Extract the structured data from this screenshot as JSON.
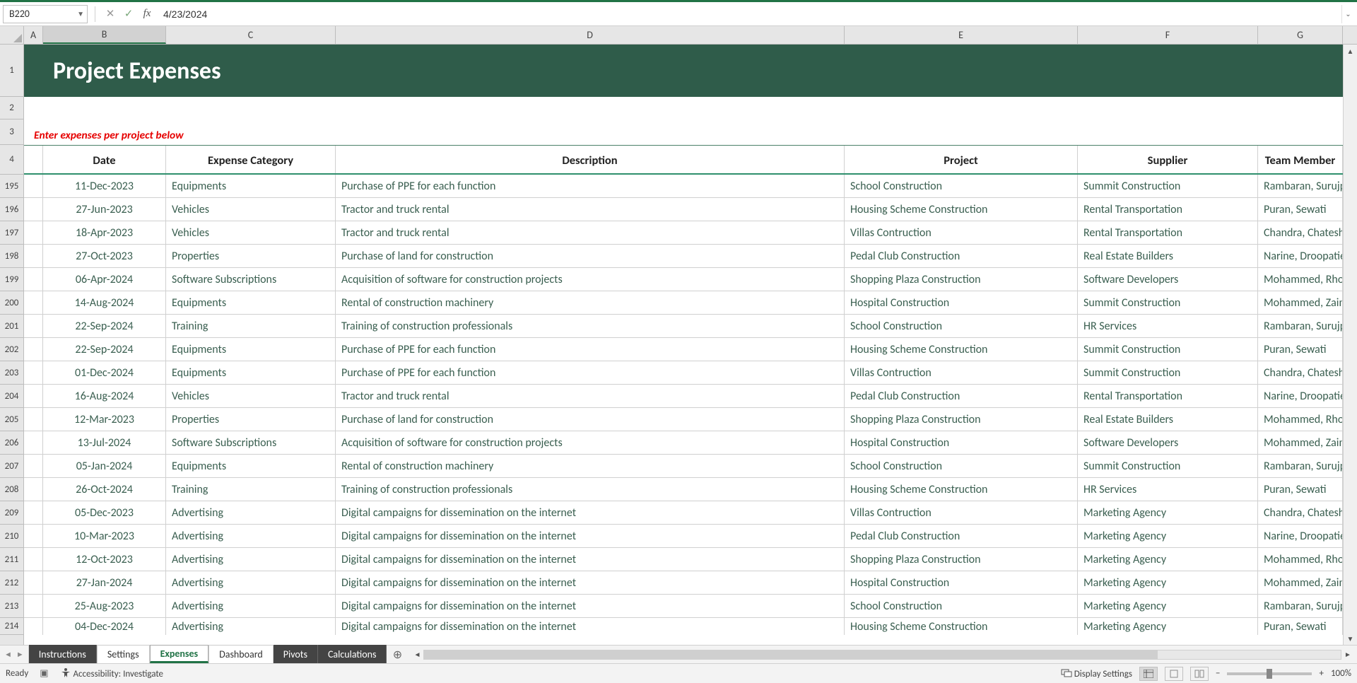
{
  "formula_bar": {
    "cell_ref": "B220",
    "formula": "4/23/2024",
    "cancel": "✕",
    "confirm": "✓",
    "fx": "fx"
  },
  "columns": [
    "A",
    "B",
    "C",
    "D",
    "E",
    "F",
    "G"
  ],
  "title": "Project Expenses",
  "instruction": "Enter expenses per project below",
  "headers": {
    "date": "Date",
    "cat": "Expense Category",
    "desc": "Description",
    "proj": "Project",
    "supp": "Supplier",
    "team": "Team Member"
  },
  "row_numbers_top": [
    "1",
    "2",
    "3",
    "4"
  ],
  "row_numbers_data": [
    "195",
    "196",
    "197",
    "198",
    "199",
    "200",
    "201",
    "202",
    "203",
    "204",
    "205",
    "206",
    "207",
    "208",
    "209",
    "210",
    "211",
    "212",
    "213",
    "214"
  ],
  "rows": [
    {
      "date": "11-Dec-2023",
      "cat": "Equipments",
      "desc": "Purchase of PPE for each function",
      "proj": "School Construction",
      "supp": "Summit Construction",
      "team": "Rambaran, Surujpaul"
    },
    {
      "date": "27-Jun-2023",
      "cat": "Vehicles",
      "desc": "Tractor and truck rental",
      "proj": "Housing Scheme Construction",
      "supp": "Rental Transportation",
      "team": "Puran, Sewati"
    },
    {
      "date": "18-Apr-2023",
      "cat": "Vehicles",
      "desc": "Tractor and truck rental",
      "proj": "Villas Contruction",
      "supp": "Rental Transportation",
      "team": "Chandra, Chateshwar"
    },
    {
      "date": "27-Oct-2023",
      "cat": "Properties",
      "desc": "Purchase of land for construction",
      "proj": "Pedal Club Construction",
      "supp": "Real Estate Builders",
      "team": "Narine, Droopatie"
    },
    {
      "date": "06-Apr-2024",
      "cat": "Software Subscriptions",
      "desc": "Acquisition of software for construction projects",
      "proj": "Shopping Plaza Construction",
      "supp": "Software Developers",
      "team": "Mohammed, Rhona"
    },
    {
      "date": "14-Aug-2024",
      "cat": "Equipments",
      "desc": "Rental of construction machinery",
      "proj": "Hospital Construction",
      "supp": "Summit Construction",
      "team": "Mohammed, Zainool"
    },
    {
      "date": "22-Sep-2024",
      "cat": "Training",
      "desc": "Training of construction professionals",
      "proj": "School Construction",
      "supp": "HR Services",
      "team": "Rambaran, Surujpaul"
    },
    {
      "date": "22-Sep-2024",
      "cat": "Equipments",
      "desc": "Purchase of PPE for each function",
      "proj": "Housing Scheme Construction",
      "supp": "Summit Construction",
      "team": "Puran, Sewati"
    },
    {
      "date": "01-Dec-2024",
      "cat": "Equipments",
      "desc": "Purchase of PPE for each function",
      "proj": "Villas Contruction",
      "supp": "Summit Construction",
      "team": "Chandra, Chateshwar"
    },
    {
      "date": "16-Aug-2024",
      "cat": "Vehicles",
      "desc": "Tractor and truck rental",
      "proj": "Pedal Club Construction",
      "supp": "Rental Transportation",
      "team": "Narine, Droopatie"
    },
    {
      "date": "12-Mar-2023",
      "cat": "Properties",
      "desc": "Purchase of land for construction",
      "proj": "Shopping Plaza Construction",
      "supp": "Real Estate Builders",
      "team": "Mohammed, Rhona"
    },
    {
      "date": "13-Jul-2024",
      "cat": "Software Subscriptions",
      "desc": "Acquisition of software for construction projects",
      "proj": "Hospital Construction",
      "supp": "Software Developers",
      "team": "Mohammed, Zainool"
    },
    {
      "date": "05-Jan-2024",
      "cat": "Equipments",
      "desc": "Rental of construction machinery",
      "proj": "School Construction",
      "supp": "Summit Construction",
      "team": "Rambaran, Surujpaul"
    },
    {
      "date": "26-Oct-2024",
      "cat": "Training",
      "desc": "Training of construction professionals",
      "proj": "Housing Scheme Construction",
      "supp": "HR Services",
      "team": "Puran, Sewati"
    },
    {
      "date": "05-Dec-2023",
      "cat": "Advertising",
      "desc": "Digital campaigns for dissemination on the internet",
      "proj": "Villas Contruction",
      "supp": "Marketing Agency",
      "team": "Chandra, Chateshwar"
    },
    {
      "date": "10-Mar-2023",
      "cat": "Advertising",
      "desc": "Digital campaigns for dissemination on the internet",
      "proj": "Pedal Club Construction",
      "supp": "Marketing Agency",
      "team": "Narine, Droopatie"
    },
    {
      "date": "12-Oct-2023",
      "cat": "Advertising",
      "desc": "Digital campaigns for dissemination on the internet",
      "proj": "Shopping Plaza Construction",
      "supp": "Marketing Agency",
      "team": "Mohammed, Rhona"
    },
    {
      "date": "27-Jan-2024",
      "cat": "Advertising",
      "desc": "Digital campaigns for dissemination on the internet",
      "proj": "Hospital Construction",
      "supp": "Marketing Agency",
      "team": "Mohammed, Zainool"
    },
    {
      "date": "25-Aug-2023",
      "cat": "Advertising",
      "desc": "Digital campaigns for dissemination on the internet",
      "proj": "School Construction",
      "supp": "Marketing Agency",
      "team": "Rambaran, Surujpaul"
    },
    {
      "date": "04-Dec-2024",
      "cat": "Advertising",
      "desc": "Digital campaigns for dissemination on the internet",
      "proj": "Housing Scheme Construction",
      "supp": "Marketing Agency",
      "team": "Puran, Sewati"
    }
  ],
  "tabs": {
    "items": [
      {
        "label": "Instructions",
        "style": "dark"
      },
      {
        "label": "Settings",
        "style": "light"
      },
      {
        "label": "Expenses",
        "style": "active"
      },
      {
        "label": "Dashboard",
        "style": "light"
      },
      {
        "label": "Pivots",
        "style": "dark"
      },
      {
        "label": "Calculations",
        "style": "dark"
      }
    ],
    "add": "⊕"
  },
  "status": {
    "ready": "Ready",
    "accessibility": "Accessibility: Investigate",
    "display_settings": "Display Settings",
    "zoom": "100%",
    "minus": "−",
    "plus": "+"
  }
}
